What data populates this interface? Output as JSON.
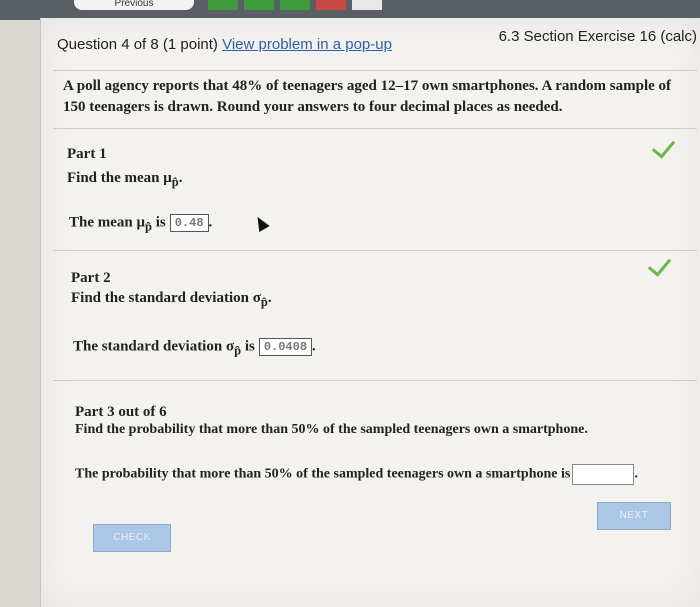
{
  "topbar": {
    "previous_label": "Previous"
  },
  "header": {
    "question_label": "Question 4 of 8 (1 point)",
    "popup_link": "View problem in a pop-up",
    "section": "6.3 Section Exercise 16 (calc)"
  },
  "problem_text": "A poll agency reports that 48% of teenagers aged 12–17 own smartphones. A random sample of 150 teenagers is drawn. Round your answers to four decimal places as needed.",
  "part1": {
    "title": "Part 1",
    "prompt": "Find the mean μ",
    "sub": "p̂",
    "prompt_end": ".",
    "answer_prefix": "The mean μ",
    "answer_sub": "p̂",
    "answer_is": "is",
    "answer_value": "0.48",
    "answer_end": "."
  },
  "part2": {
    "title": "Part 2",
    "prompt": "Find the standard deviation σ",
    "sub": "p̂",
    "prompt_end": ".",
    "answer_prefix": "The standard deviation σ",
    "answer_sub": "p̂",
    "answer_is": "is",
    "answer_value": "0.0408",
    "answer_end": "."
  },
  "part3": {
    "title": "Part 3 out of 6",
    "prompt": "Find the probability that more than 50% of the sampled teenagers own a smartphone.",
    "answer_prefix": "The probability that more than 50% of the sampled teenagers own a smartphone is",
    "answer_end": "."
  },
  "buttons": {
    "check": "CHECK",
    "next": "NEXT"
  },
  "colors": {
    "accent_check": "#67b845",
    "button": "#aac7e6",
    "link": "#2c5ea8"
  }
}
